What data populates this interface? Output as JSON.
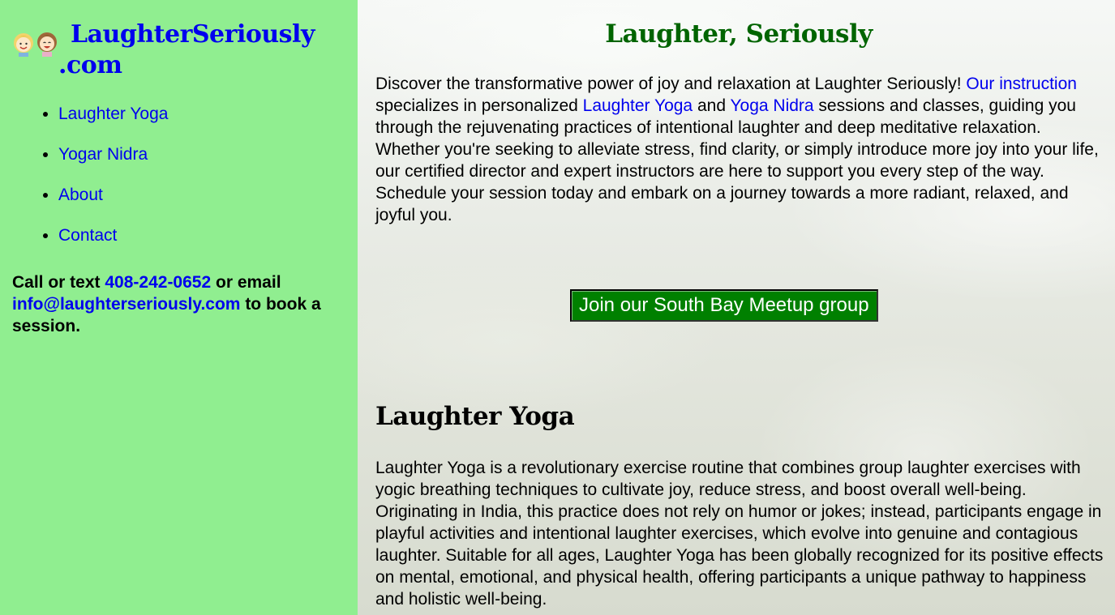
{
  "sidebar": {
    "brand": {
      "logo_icon": "two-smiling-faces-logo",
      "line1": "LaughterSeriously",
      "line2": ".com"
    },
    "nav": [
      {
        "label": "Laughter Yoga"
      },
      {
        "label": "Yogar Nidra"
      },
      {
        "label": "About"
      },
      {
        "label": "Contact"
      }
    ],
    "contact": {
      "prefix": "Call or text ",
      "phone": "408-242-0652",
      "middle": " or email ",
      "email": "info@laughterseriously.com",
      "suffix": " to book a session."
    }
  },
  "main": {
    "title": "Laughter, Seriously",
    "intro": {
      "t1": "Discover the transformative power of joy and relaxation at Laughter Seriously! ",
      "link1": "Our instruction",
      "t2": " specializes in personalized ",
      "link2": "Laughter Yoga",
      "t3": " and ",
      "link3": "Yoga Nidra",
      "t4": " sessions and classes, guiding you through the rejuvenating practices of intentional laughter and deep meditative relaxation. Whether you're seeking to alleviate stress, find clarity, or simply introduce more joy into your life, our certified director and expert instructors are here to support you every step of the way. Schedule your session today and embark on a journey towards a more radiant, relaxed, and joyful you."
    },
    "meetup_button": "Join our South Bay Meetup group",
    "section": {
      "heading": "Laughter Yoga",
      "body": "Laughter Yoga is a revolutionary exercise routine that combines group laughter exercises with yogic breathing techniques to cultivate joy, reduce stress, and boost overall well-being. Originating in India, this practice does not rely on humor or jokes; instead, participants engage in playful activities and intentional laughter exercises, which evolve into genuine and contagious laughter. Suitable for all ages, Laughter Yoga has been globally recognized for its positive effects on mental, emotional, and physical health, offering participants a unique pathway to happiness and holistic well-being."
    }
  },
  "colors": {
    "sidebar_bg": "#90ee90",
    "link": "#0000ee",
    "title_green": "#006400",
    "button_bg": "#008000"
  }
}
